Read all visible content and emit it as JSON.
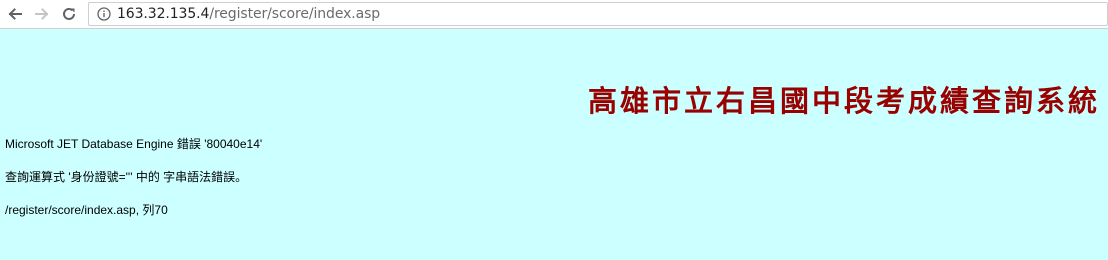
{
  "browser": {
    "url_host": "163.32.135.4",
    "url_path": "/register/score/index.asp",
    "icons": {
      "back": "back-arrow-icon",
      "forward": "forward-arrow-icon",
      "reload": "reload-icon",
      "site_info": "info-icon"
    }
  },
  "page": {
    "banner_title": "高雄市立右昌國中段考成績查詢系統",
    "error_title": "Microsoft JET Database Engine 錯誤 '80040e14'",
    "error_description": "查詢運算式 '身份證號=''' 中的 字串語法錯誤。",
    "error_location": "/register/score/index.asp, 列70"
  },
  "colors": {
    "page_background": "#ccffff",
    "banner_text": "#990000"
  }
}
